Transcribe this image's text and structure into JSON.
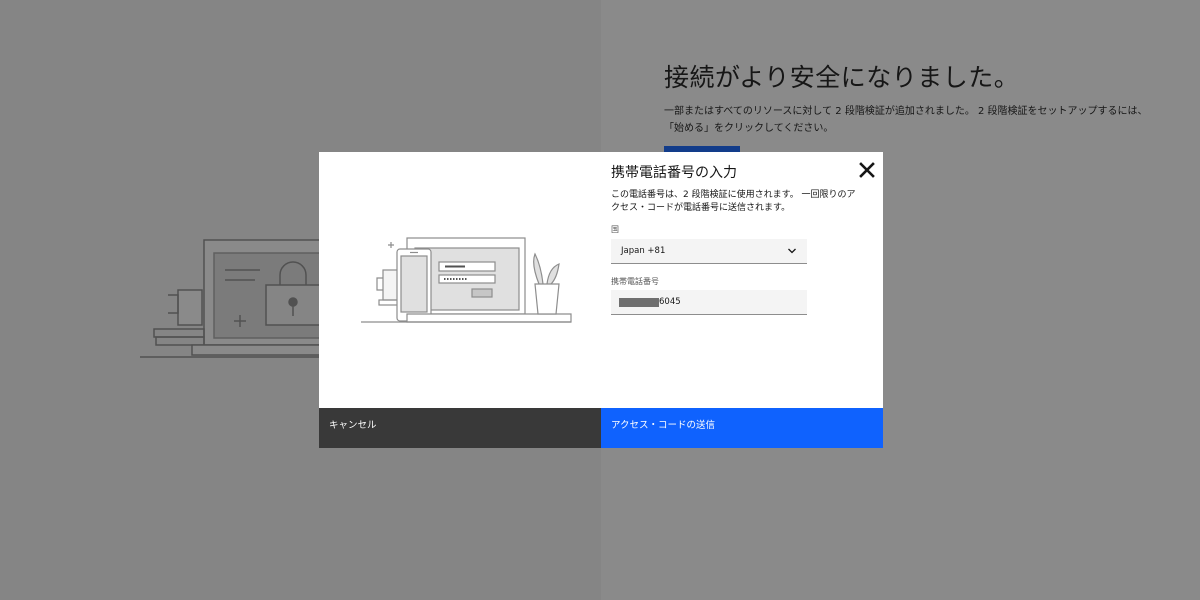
{
  "background": {
    "title": "接続がより安全になりました。",
    "description_line1": "一部またはすべてのリソースに対して 2 段階検証が追加されました。 2 段階検証をセットアップするには、",
    "description_line2": "「始める」をクリックしてください。",
    "illustration_icon": "laptop-lock-icon"
  },
  "modal": {
    "title": "携帯電話番号の入力",
    "close_icon": "close-icon",
    "description_line1": "この電話番号は、2 段階検証に使用されます。 一回限りのア",
    "description_line2": "クセス・コードが電話番号に送信されます。",
    "illustration_icon": "phone-laptop-login-icon",
    "country": {
      "label": "国",
      "value": "Japan +81",
      "icon": "chevron-down-icon"
    },
    "phone": {
      "label": "携帯電話番号",
      "value": "6045"
    },
    "cancel_label": "キャンセル",
    "send_label": "アクセス・コードの送信"
  },
  "colors": {
    "primary": "#0f62fe",
    "secondary": "#393939",
    "overlay": "rgba(22,22,22,0.5)"
  }
}
